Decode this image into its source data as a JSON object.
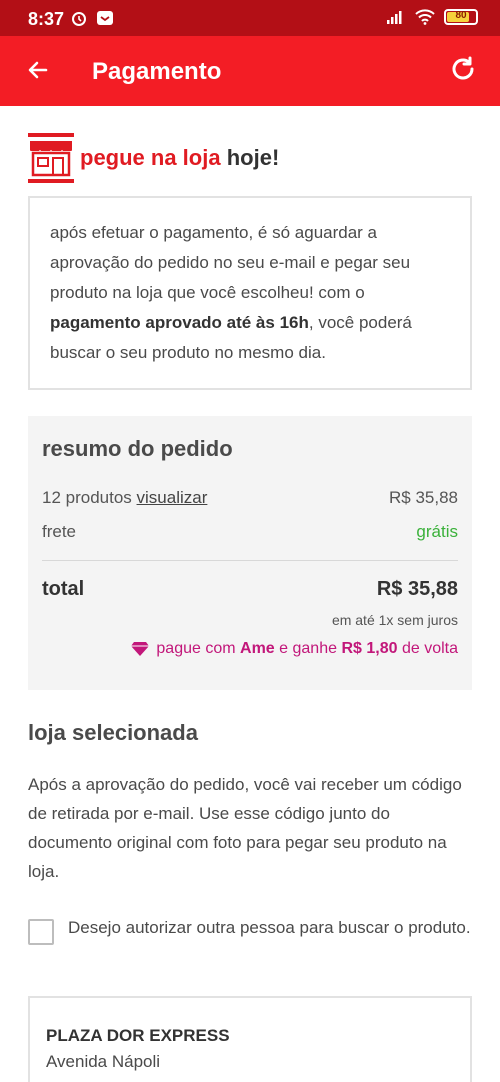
{
  "status_bar": {
    "time": "8:37",
    "battery": "80",
    "battery_level": 0.8
  },
  "app_bar": {
    "title": "Pagamento",
    "back_icon": "arrow-left-icon",
    "refresh_icon": "refresh-icon"
  },
  "pickup": {
    "icon": "store-icon",
    "highlight": "pegue na loja",
    "rest": "hoje!"
  },
  "info": {
    "part1": "após efetuar o pagamento, é só aguardar a aprovação do pedido no seu e-mail e pegar seu produto na loja que você escolheu! com o",
    "bold": "pagamento aprovado até às 16h",
    "part2": ", você poderá buscar o seu produto no mesmo dia."
  },
  "summary": {
    "title": "resumo do pedido",
    "products_label": "12 produtos",
    "view_link": "visualizar",
    "products_value": "R$ 35,88",
    "freight_label": "frete",
    "freight_value": "grátis",
    "total_label": "total",
    "total_value": "R$ 35,88",
    "installments": "em até 1x sem juros",
    "ame_prefix": "pague com",
    "ame_brand": "Ame",
    "ame_mid": "e ganhe",
    "ame_amount": "R$ 1,80",
    "ame_suffix": "de volta"
  },
  "store_section": {
    "title": "loja selecionada",
    "text": "Após a aprovação do pedido, você vai receber um código de retirada por e-mail. Use esse código junto do documento original com foto para pegar seu produto na loja.",
    "authorize_label": "Desejo autorizar outra pessoa para buscar o produto.",
    "authorize_checked": false
  },
  "store": {
    "name": "PLAZA DOR EXPRESS",
    "address": "Avenida Nápoli"
  },
  "colors": {
    "status_bar": "#b30f16",
    "app_bar": "#f31d25",
    "accent_red": "#e01b22",
    "free_green": "#3ab13a",
    "ame_pink": "#c2177a"
  }
}
